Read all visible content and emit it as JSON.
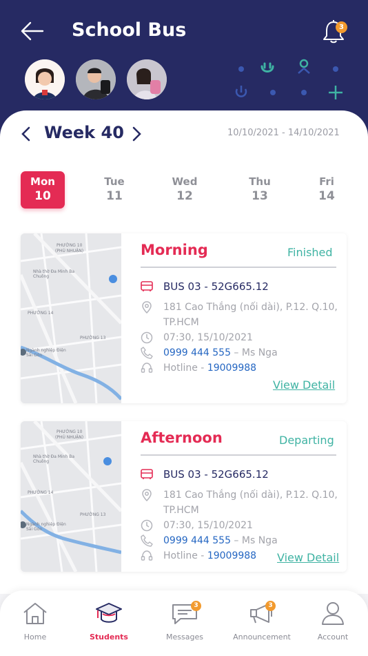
{
  "header": {
    "title": "School Bus",
    "notification_count": "3"
  },
  "week": {
    "label": "Week 40",
    "range": "10/10/2021 - 14/10/2021"
  },
  "days": [
    {
      "name": "Mon",
      "date": "10"
    },
    {
      "name": "Tue",
      "date": "11"
    },
    {
      "name": "Wed",
      "date": "12"
    },
    {
      "name": "Thu",
      "date": "13"
    },
    {
      "name": "Fri",
      "date": "14"
    }
  ],
  "trips": [
    {
      "period": "Morning",
      "status": "Finished",
      "bus": "BUS 03 - 52G665.12",
      "address_line1": "181 Cao Thắng (nối dài), P.12. Q.10,",
      "address_line2": "TP.HCM",
      "time": "07:30, 15/10/2021",
      "phone": "0999 444 555",
      "driver": " – Ms Nga",
      "hotline_label": "Hotline - ",
      "hotline": "19009988",
      "detail": "View Detail"
    },
    {
      "period": "Afternoon",
      "status": "Departing",
      "bus": "BUS 03 - 52G665.12",
      "address_line1": "181 Cao Thắng (nối dài), P.12. Q.10,",
      "address_line2": "TP.HCM",
      "time": "07:30, 15/10/2021",
      "phone": "0999 444 555",
      "driver": " – Ms Nga",
      "hotline_label": "Hotline - ",
      "hotline": "19009988",
      "detail": "View Detail"
    }
  ],
  "map_labels": {
    "ward10": "PHƯỜNG 10",
    "ward10b": "(PHÚ NHUẬN)",
    "temple": "Nhà thờ Đa Minh Ba Chuông",
    "ward14": "PHƯỜNG 14",
    "ward13": "PHƯỜNG 13",
    "school": "Ngành nghiệp Điện Sài Gòn"
  },
  "nav": [
    {
      "label": "Home",
      "icon": "home-icon"
    },
    {
      "label": "Students",
      "icon": "graduation-cap-icon"
    },
    {
      "label": "Messages",
      "icon": "message-icon",
      "badge": "3"
    },
    {
      "label": "Announcement",
      "icon": "megaphone-icon",
      "badge": "3"
    },
    {
      "label": "Account",
      "icon": "user-icon"
    }
  ],
  "colors": {
    "primary": "#262a63",
    "accent": "#e42b54",
    "teal": "#3fb3a3",
    "link": "#2466c2"
  }
}
